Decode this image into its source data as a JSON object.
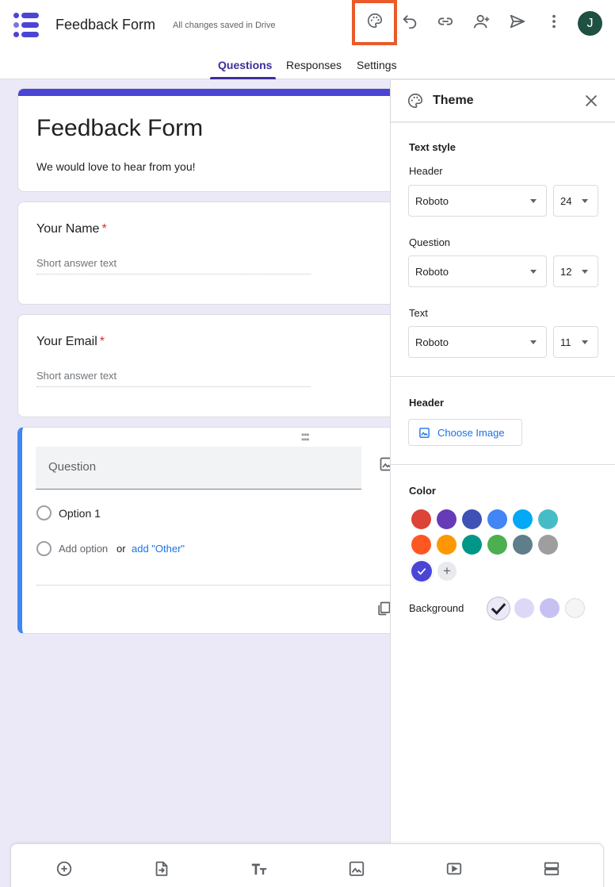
{
  "header": {
    "app_title": "Feedback Form",
    "save_status": "All changes saved in Drive",
    "avatar_initial": "J",
    "icons": [
      "palette-icon",
      "undo-icon",
      "link-icon",
      "add-collaborator-icon",
      "send-icon",
      "more-vert-icon"
    ],
    "highlight_color": "#ea5a2a"
  },
  "tabs": [
    {
      "label": "Questions",
      "active": true
    },
    {
      "label": "Responses",
      "active": false
    },
    {
      "label": "Settings",
      "active": false
    }
  ],
  "form": {
    "title": "Feedback Form",
    "description": "We would love to hear from you!",
    "accent_color": "#4b45d6",
    "questions": [
      {
        "title": "Your Name",
        "required_mark": "*",
        "placeholder": "Short answer text"
      },
      {
        "title": "Your Email",
        "required_mark": "*",
        "placeholder": "Short answer text"
      }
    ],
    "active_question": {
      "placeholder": "Question",
      "option_1": "Option 1",
      "add_option": "Add option",
      "or_text": "or",
      "add_other": "add \"Other\""
    }
  },
  "theme_panel": {
    "title": "Theme",
    "text_style_label": "Text style",
    "header_label": "Header",
    "header_font": "Roboto",
    "header_size": "24",
    "question_label": "Question",
    "question_font": "Roboto",
    "question_size": "12",
    "text_label": "Text",
    "text_font": "Roboto",
    "text_size": "11",
    "header_section_label": "Header",
    "choose_image_label": "Choose Image",
    "color_label": "Color",
    "colors": [
      "#db4437",
      "#673ab7",
      "#3f51b5",
      "#4285f4",
      "#03a9f4",
      "#46bdc6",
      "#ff5722",
      "#ff9800",
      "#009688",
      "#4caf50",
      "#607d8b",
      "#9e9e9e",
      "#4b45d6"
    ],
    "selected_color": "#4b45d6",
    "add_color_label": "+",
    "background_label": "Background",
    "backgrounds": [
      "#ebe9f7",
      "#dcd9f7",
      "#c7c1f2",
      "#f5f5f5"
    ],
    "selected_background": "#ebe9f7"
  },
  "bottom_toolbar": {
    "icons": [
      "add-question-icon",
      "import-questions-icon",
      "add-title-icon",
      "add-image-icon",
      "add-video-icon",
      "add-section-icon"
    ]
  }
}
